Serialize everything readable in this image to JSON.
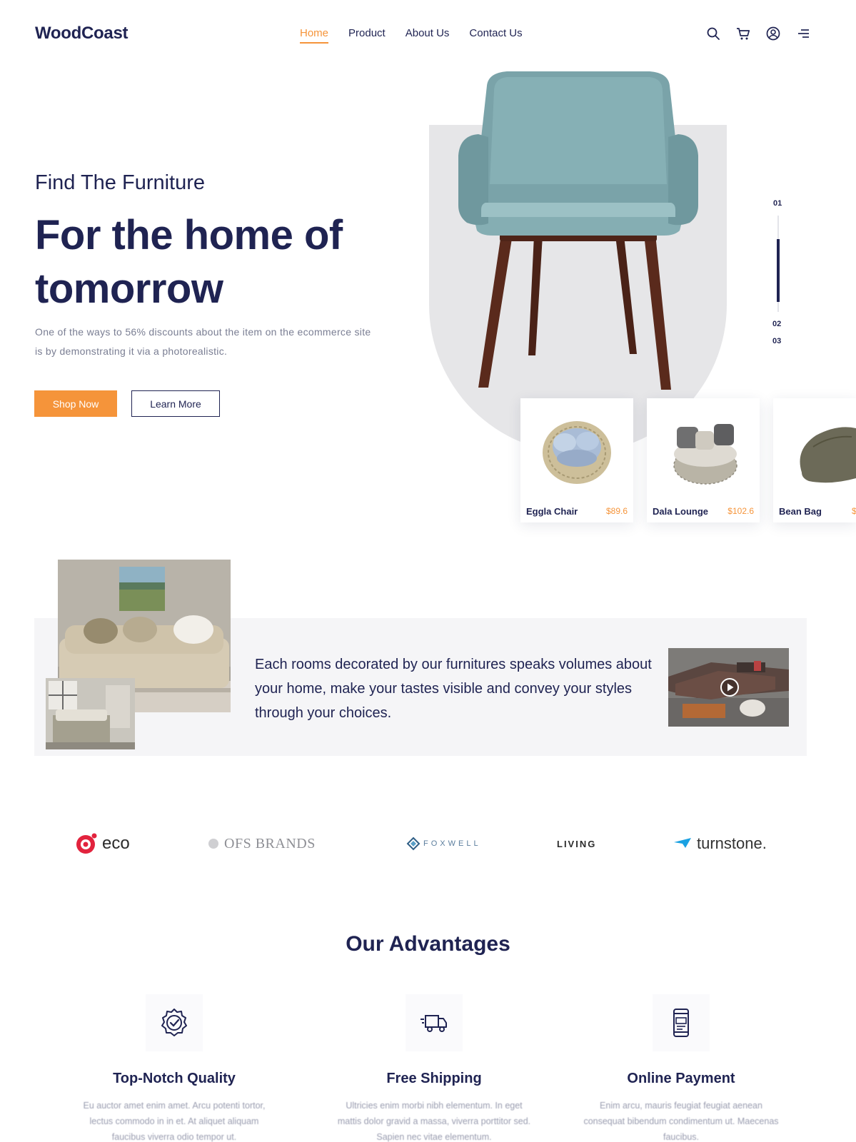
{
  "brand": {
    "name": "WoodCoast"
  },
  "nav": {
    "items": [
      {
        "label": "Home",
        "active": true
      },
      {
        "label": "Product",
        "active": false
      },
      {
        "label": "About Us",
        "active": false
      },
      {
        "label": "Contact Us",
        "active": false
      }
    ],
    "icons": [
      "search-icon",
      "cart-icon",
      "user-icon",
      "menu-icon"
    ]
  },
  "hero": {
    "kicker": "Find The Furniture",
    "title": "For the home of tomorrow",
    "description": "One of the ways to 56% discounts about the item on the ecommerce site is by demonstrating it via a photorealistic.",
    "primary_button": "Shop Now",
    "secondary_button": "Learn More",
    "slides": {
      "first": "01",
      "second": "02",
      "third": "03",
      "progress": 0.7
    }
  },
  "products": [
    {
      "name": "Eggla Chair",
      "price": "$89.6"
    },
    {
      "name": "Dala Lounge",
      "price": "$102.6"
    },
    {
      "name": "Bean Bag",
      "price": "$"
    }
  ],
  "rooms": {
    "text": "Each rooms decorated by our furnitures speaks volumes about your home, make your tastes visible and convey your styles through your choices."
  },
  "brands": {
    "eco": "eco",
    "ofs": "OFS BRANDS",
    "foxwell": "FOXWELL",
    "living": "LIVING",
    "turnstone": "turnstone."
  },
  "advantages": {
    "title": "Our Advantages",
    "items": [
      {
        "title": "Top-Notch Quality",
        "text": "Eu auctor amet enim amet. Arcu potenti tortor, lectus commodo in in et. At aliquet aliquam faucibus viverra odio tempor ut."
      },
      {
        "title": "Free Shipping",
        "text": "Ultricies enim morbi nibh elementum. In eget mattis dolor gravid a massa, viverra porttitor sed. Sapien nec vitae elementum."
      },
      {
        "title": "Online Payment",
        "text": "Enim arcu, mauris feugiat feugiat aenean consequat bibendum condimentum ut. Maecenas faucibus."
      }
    ]
  },
  "colors": {
    "primary": "#1f2352",
    "accent": "#f5943a",
    "muted": "#7a7e93",
    "panel": "#e6e6e8"
  }
}
